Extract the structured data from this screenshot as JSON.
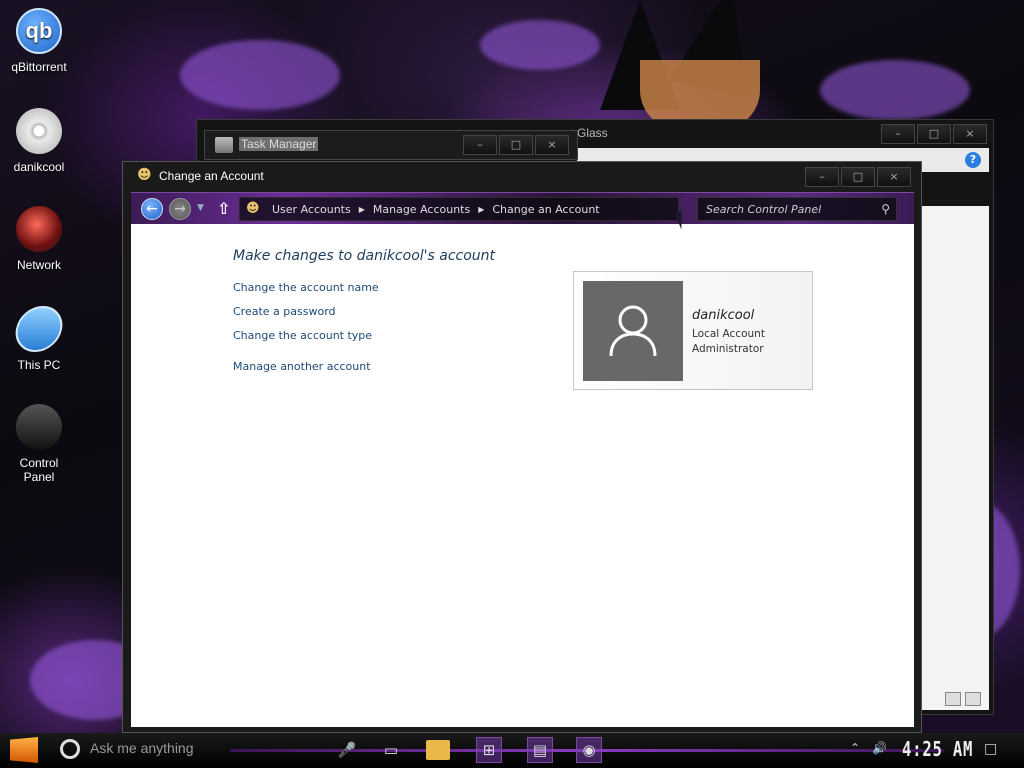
{
  "desktop": {
    "icons": [
      {
        "label": "qBittorrent",
        "glyph": "qb"
      },
      {
        "label": "danikcool"
      },
      {
        "label": "Network"
      },
      {
        "label": "This PC"
      },
      {
        "label": "Control Panel"
      }
    ]
  },
  "back_window": {
    "title_fragment": "Glass",
    "help_glyph": "?"
  },
  "task_manager": {
    "title": "Task Manager"
  },
  "window": {
    "title": "Change an Account",
    "controls": {
      "minimize": "–",
      "maximize": "□",
      "close": "×"
    }
  },
  "navbar": {
    "breadcrumbs": [
      "User Accounts",
      "Manage Accounts",
      "Change an Account"
    ],
    "search_placeholder": "Search Control Panel"
  },
  "content": {
    "heading": "Make changes to danikcool's account",
    "links": [
      "Change the account name",
      "Create a password",
      "Change the account type"
    ],
    "manage_link": "Manage another account",
    "account": {
      "name": "danikcool",
      "type": "Local Account",
      "role": "Administrator"
    }
  },
  "taskbar": {
    "search_text": "Ask me anything",
    "clock": "4:25 AM"
  },
  "colors": {
    "accent": "#8a3cc2",
    "heading": "#1e3c5e",
    "link": "#1e4a7a"
  }
}
